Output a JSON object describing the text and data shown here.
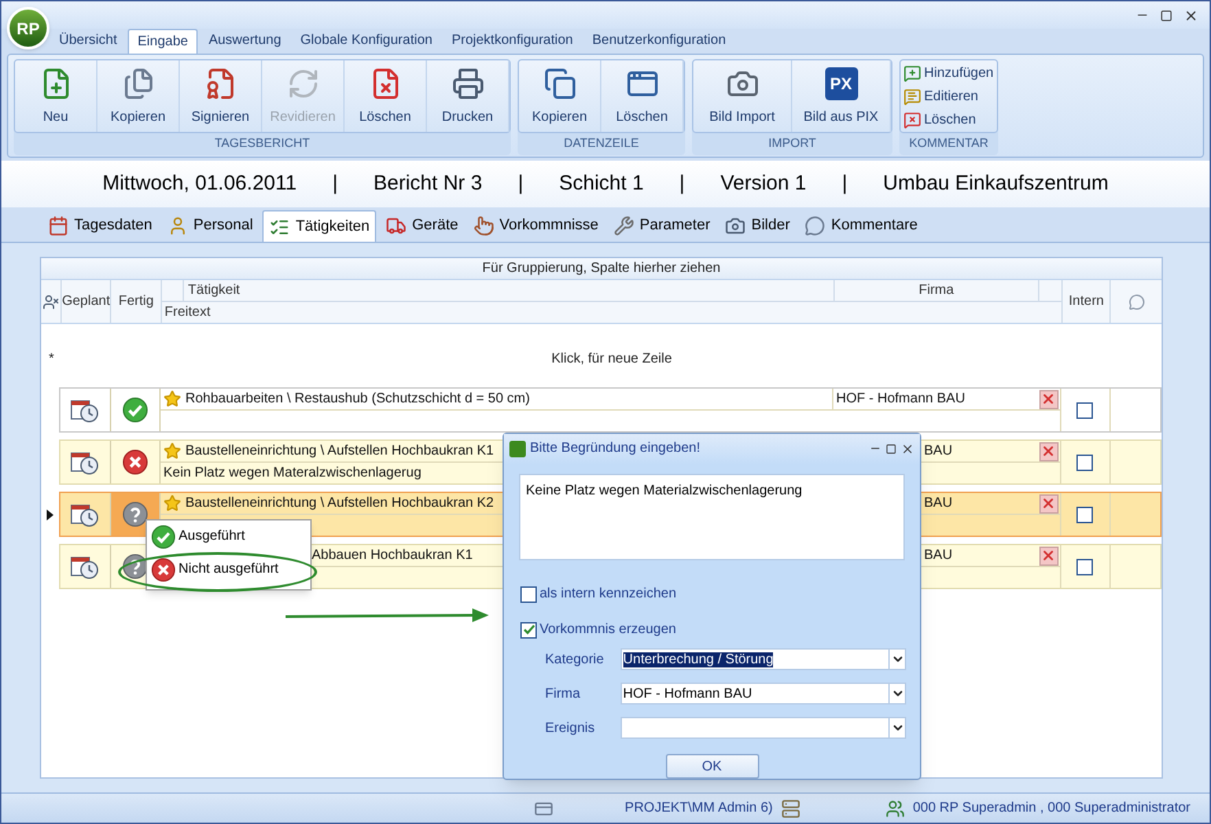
{
  "window": {
    "logo": "RP"
  },
  "menu_tabs": [
    {
      "label": "Übersicht",
      "selected": false
    },
    {
      "label": "Eingabe",
      "selected": true
    },
    {
      "label": "Auswertung",
      "selected": false
    },
    {
      "label": "Globale Konfiguration",
      "selected": false
    },
    {
      "label": "Projektkonfiguration",
      "selected": false
    },
    {
      "label": "Benutzerkonfiguration",
      "selected": false
    }
  ],
  "ribbon": {
    "groups": [
      {
        "title": "TAGESBERICHT",
        "kind": "large",
        "buttons": [
          {
            "label": "Neu",
            "disabled": false
          },
          {
            "label": "Kopieren",
            "disabled": false
          },
          {
            "label": "Signieren",
            "disabled": false
          },
          {
            "label": "Revidieren",
            "disabled": true
          },
          {
            "label": "Löschen",
            "disabled": false
          },
          {
            "label": "Drucken",
            "disabled": false
          }
        ]
      },
      {
        "title": "DATENZEILE",
        "kind": "large",
        "buttons": [
          {
            "label": "Kopieren",
            "disabled": false
          },
          {
            "label": "Löschen",
            "disabled": false
          }
        ]
      },
      {
        "title": "IMPORT",
        "kind": "large",
        "buttons": [
          {
            "label": "Bild Import",
            "disabled": false
          },
          {
            "label": "Bild aus PIX",
            "disabled": false,
            "badge": "PX"
          }
        ]
      },
      {
        "title": "KOMMENTAR",
        "kind": "small",
        "buttons": [
          {
            "label": "Hinzufügen",
            "disabled": false
          },
          {
            "label": "Editieren",
            "disabled": false
          },
          {
            "label": "Löschen",
            "disabled": false
          }
        ]
      }
    ]
  },
  "report_header": [
    "Mittwoch, 01.06.2011",
    "|",
    "Bericht Nr 3",
    "|",
    "Schicht 1",
    "|",
    "Version 1",
    "|",
    "Umbau Einkaufszentrum"
  ],
  "view_tabs": [
    {
      "label": "Tagesdaten",
      "selected": false
    },
    {
      "label": "Personal",
      "selected": false
    },
    {
      "label": "Tätigkeiten",
      "selected": true
    },
    {
      "label": "Geräte",
      "selected": false
    },
    {
      "label": "Vorkommnisse",
      "selected": false
    },
    {
      "label": "Parameter",
      "selected": false
    },
    {
      "label": "Bilder",
      "selected": false
    },
    {
      "label": "Kommentare",
      "selected": false
    }
  ],
  "grid": {
    "group_hint": "Für Gruppierung, Spalte hierher ziehen",
    "columns": {
      "geplant": "Geplant",
      "fertig": "Fertig",
      "taetigkeit": "Tätigkeit",
      "firma": "Firma",
      "freitext": "Freitext",
      "intern": "Intern"
    },
    "new_row": {
      "marker": "*",
      "text": "Klick, für neue Zeile"
    },
    "rows": [
      {
        "kind": "done",
        "selected": false,
        "taetigkeit": "Rohbauarbeiten \\ Restaushub (Schutzschicht d =  50 cm)",
        "firma": "HOF - Hofmann BAU",
        "intern": false
      },
      {
        "kind": "not_done",
        "selected": false,
        "taetigkeit": "Baustelleneinrichtung \\ Aufstellen Hochbaukran K1",
        "freitext": "Kein Platz wegen Materalzwischenlagerug",
        "firma": "BAU",
        "intern": false
      },
      {
        "kind": "unknown",
        "selected": true,
        "taetigkeit": "Baustelleneinrichtung \\ Aufstellen Hochbaukran K2",
        "firma": "BAU",
        "intern": false
      },
      {
        "kind": "unknown",
        "selected": false,
        "taetigkeit": "Abbauen Hochbaukran K1",
        "firma": "BAU",
        "intern": false
      }
    ]
  },
  "status_menu": [
    {
      "kind": "done",
      "label": "Ausgeführt"
    },
    {
      "kind": "not_done",
      "label": "Nicht ausgeführt"
    }
  ],
  "dialog": {
    "title": "Bitte Begründung eingeben!",
    "text": "Keine Platz wegen Materialzwischenlagerung",
    "checkboxes": [
      {
        "label": "als intern kennzeichen",
        "checked": false
      },
      {
        "label": "Vorkommnis erzeugen",
        "checked": true
      }
    ],
    "fields": [
      {
        "label": "Kategorie",
        "value": "Unterbrechung / Störung",
        "highlighted": true
      },
      {
        "label": "Firma",
        "value": "HOF - Hofmann BAU",
        "highlighted": false
      },
      {
        "label": "Ereignis"
      }
    ],
    "ok": "OK"
  },
  "status_bar": {
    "project": "PROJEKT\\MM Admin 6)",
    "user": "000 RP Superadmin , 000 Superadministrator"
  }
}
